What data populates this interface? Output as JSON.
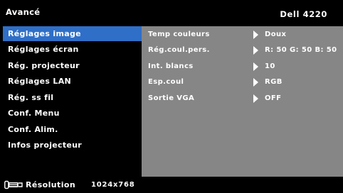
{
  "header": {
    "title": "Avancé",
    "model": "Dell 4220"
  },
  "sidebar": {
    "items": [
      {
        "label": "Réglages image",
        "active": true
      },
      {
        "label": "Réglages écran",
        "active": false
      },
      {
        "label": "Rég. projecteur",
        "active": false
      },
      {
        "label": "Réglages LAN",
        "active": false
      },
      {
        "label": "Rég. ss fil",
        "active": false
      },
      {
        "label": "Conf. Menu",
        "active": false
      },
      {
        "label": "Conf. Alim.",
        "active": false
      },
      {
        "label": "Infos projecteur",
        "active": false
      }
    ]
  },
  "settings": {
    "rows": [
      {
        "label": "Temp couleurs",
        "value": "Doux"
      },
      {
        "label": "Rég.coul.pers.",
        "value": "R: 50 G: 50 B: 50"
      },
      {
        "label": "Int. blancs",
        "value": "10"
      },
      {
        "label": "Esp.coul",
        "value": "RGB"
      },
      {
        "label": "Sortie VGA",
        "value": "OFF"
      }
    ]
  },
  "footer": {
    "icon": "input-source-icon",
    "label": "Résolution",
    "value": "1024x768"
  },
  "colors": {
    "background": "#000000",
    "highlight": "#2f6fc7",
    "panel": "#868686",
    "text": "#ffffff"
  }
}
